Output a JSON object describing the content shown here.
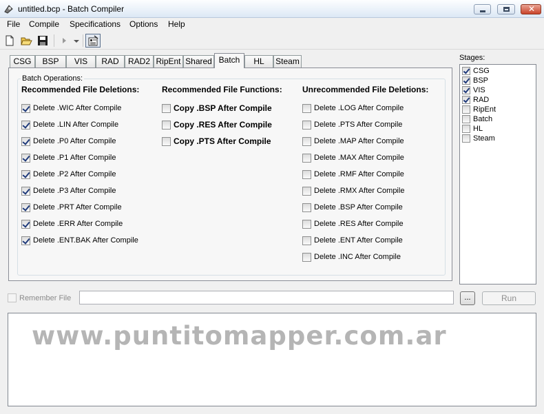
{
  "window": {
    "title": "untitled.bcp - Batch Compiler"
  },
  "menu": [
    "File",
    "Compile",
    "Specifications",
    "Options",
    "Help"
  ],
  "toolbar": {
    "icons": [
      "new-file-icon",
      "open-folder-icon",
      "save-icon",
      "run-arrow-icon",
      "dropdown-arrow-icon",
      "properties-icon"
    ]
  },
  "tabs": [
    {
      "label": "CSG",
      "active": false
    },
    {
      "label": "BSP",
      "active": false
    },
    {
      "label": "VIS",
      "active": false
    },
    {
      "label": "RAD",
      "active": false
    },
    {
      "label": "RAD2",
      "active": false
    },
    {
      "label": "RipEnt",
      "active": false
    },
    {
      "label": "Shared",
      "active": false
    },
    {
      "label": "Batch",
      "active": true
    },
    {
      "label": "HL",
      "active": false
    },
    {
      "label": "Steam",
      "active": false
    }
  ],
  "batch": {
    "group_label": "Batch Operations:",
    "recommended_deletions": {
      "heading": "Recommended File Deletions:",
      "items": [
        {
          "label": "Delete .WIC After Compile",
          "checked": true
        },
        {
          "label": "Delete .LIN After Compile",
          "checked": true
        },
        {
          "label": "Delete .P0 After Compile",
          "checked": true
        },
        {
          "label": "Delete .P1 After Compile",
          "checked": true
        },
        {
          "label": "Delete .P2 After Compile",
          "checked": true
        },
        {
          "label": "Delete .P3 After Compile",
          "checked": true
        },
        {
          "label": "Delete .PRT After Compile",
          "checked": true
        },
        {
          "label": "Delete .ERR After Compile",
          "checked": true
        },
        {
          "label": "Delete .ENT.BAK After Compile",
          "checked": true
        }
      ]
    },
    "recommended_functions": {
      "heading": "Recommended File Functions:",
      "items": [
        {
          "label": "Copy .BSP After Compile",
          "checked": false
        },
        {
          "label": "Copy .RES After Compile",
          "checked": false
        },
        {
          "label": "Copy .PTS After Compile",
          "checked": false
        }
      ]
    },
    "unrecommended_deletions": {
      "heading": "Unrecommended File Deletions:",
      "items": [
        {
          "label": "Delete .LOG After Compile",
          "checked": false
        },
        {
          "label": "Delete .PTS After Compile",
          "checked": false
        },
        {
          "label": "Delete .MAP After Compile",
          "checked": false
        },
        {
          "label": "Delete .MAX After Compile",
          "checked": false
        },
        {
          "label": "Delete .RMF After Compile",
          "checked": false
        },
        {
          "label": "Delete .RMX After Compile",
          "checked": false
        },
        {
          "label": "Delete .BSP After Compile",
          "checked": false
        },
        {
          "label": "Delete .RES After Compile",
          "checked": false
        },
        {
          "label": "Delete .ENT After Compile",
          "checked": false
        },
        {
          "label": "Delete .INC After Compile",
          "checked": false
        }
      ]
    }
  },
  "stages": {
    "label": "Stages:",
    "items": [
      {
        "label": "CSG",
        "checked": true
      },
      {
        "label": "BSP",
        "checked": true
      },
      {
        "label": "VIS",
        "checked": true
      },
      {
        "label": "RAD",
        "checked": true
      },
      {
        "label": "RipEnt",
        "checked": false
      },
      {
        "label": "Batch",
        "checked": false
      },
      {
        "label": "HL",
        "checked": false
      },
      {
        "label": "Steam",
        "checked": false
      }
    ]
  },
  "bottom": {
    "remember_label": "Remember File",
    "remember_checked": false,
    "file_value": "",
    "browse_label": "...",
    "run_label": "Run"
  },
  "output": {
    "watermark": "www.puntitomapper.com.ar"
  }
}
